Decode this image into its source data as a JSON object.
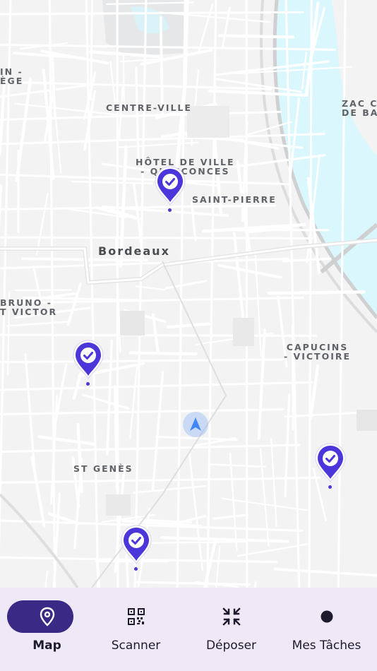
{
  "map": {
    "labels": {
      "left_partial": "IN -\nÈGE",
      "centre_ville": "CENTRE-VILLE",
      "hotel_de_ville": "HÔTEL DE VILLE\n- QUINCONCES",
      "saint_pierre": "SAINT-PIERRE",
      "zac": "ZAC C\nDE BA",
      "bordeaux": "Bordeaux",
      "bruno_victor": "BRUNO -\nT VICTOR",
      "capucins": "CAPUCINS\n- VICTOIRE",
      "st_genes": "ST GENÈS"
    },
    "markers": [
      {
        "name": "task-marker-hotel-de-ville",
        "status": "done"
      },
      {
        "name": "task-marker-west",
        "status": "done"
      },
      {
        "name": "task-marker-east",
        "status": "done"
      },
      {
        "name": "task-marker-south",
        "status": "done"
      }
    ],
    "colors": {
      "water": "#d9f7fc",
      "marker": "#4a36d9",
      "current_location": "#4285f4"
    }
  },
  "nav": {
    "items": [
      {
        "label": "Map",
        "icon": "map-pin-icon",
        "active": true
      },
      {
        "label": "Scanner",
        "icon": "qr-code-icon",
        "active": false
      },
      {
        "label": "Déposer",
        "icon": "collapse-arrows-icon",
        "active": false
      },
      {
        "label": "Mes Tâches",
        "icon": "dot-icon",
        "active": false
      }
    ],
    "colors": {
      "bar_bg": "#efe9f7",
      "active_indicator": "#3a2a86",
      "icon": "#1f1b2e"
    }
  }
}
